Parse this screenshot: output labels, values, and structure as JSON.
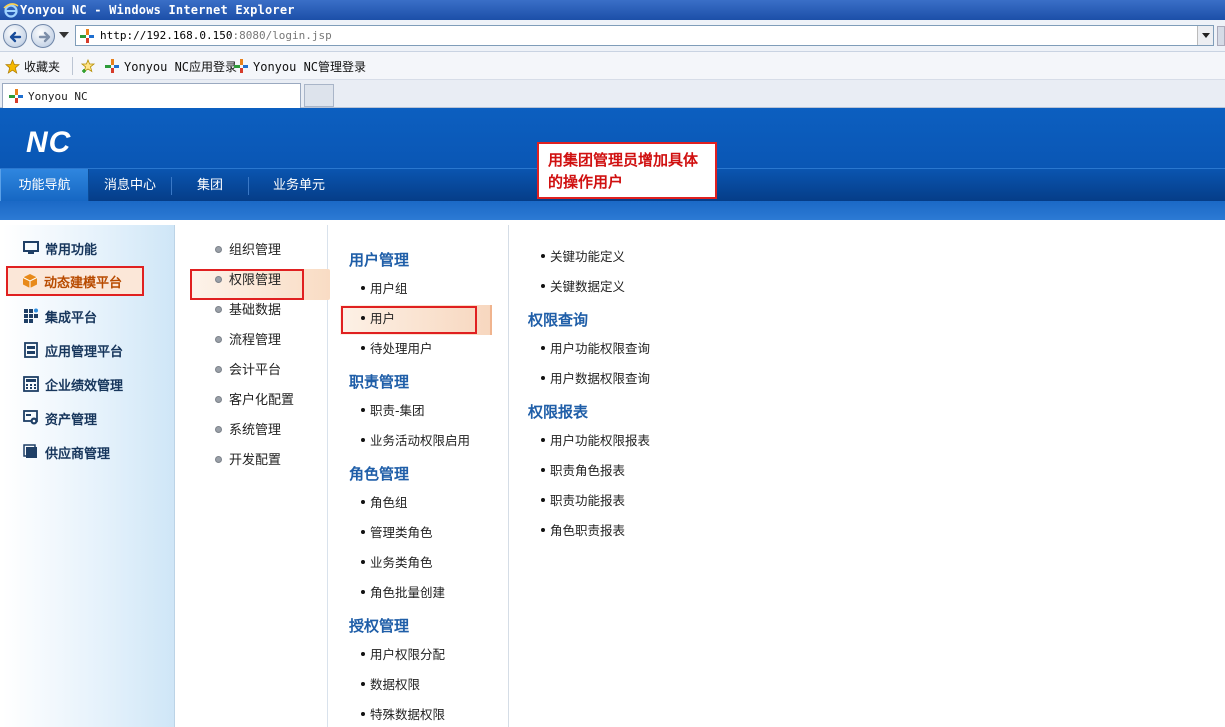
{
  "browser": {
    "window_title": "Yonyou NC - Windows Internet Explorer",
    "url_host": "http://192.168.0.150",
    "url_path": ":8080/login.jsp",
    "favorites_label": "收藏夹",
    "favorites": [
      "Yonyou NC应用登录",
      "Yonyou NC管理登录"
    ],
    "tab_title": "Yonyou NC"
  },
  "app": {
    "logo": "NC",
    "tabs": [
      "功能导航",
      "消息中心",
      "集团",
      "业务单元"
    ],
    "active_tab": "功能导航",
    "callout": "用集团管理员增加具体的操作用户",
    "callout_color": "#e02020"
  },
  "left_nav": [
    {
      "label": "常用功能",
      "icon": "monitor-icon"
    },
    {
      "label": "动态建模平台",
      "icon": "cube-icon",
      "active": true
    },
    {
      "label": "集成平台",
      "icon": "grid-icon"
    },
    {
      "label": "应用管理平台",
      "icon": "server-icon"
    },
    {
      "label": "企业绩效管理",
      "icon": "calculator-icon"
    },
    {
      "label": "资产管理",
      "icon": "asset-icon"
    },
    {
      "label": "供应商管理",
      "icon": "supplier-icon"
    }
  ],
  "modules": [
    {
      "label": "组织管理"
    },
    {
      "label": "权限管理",
      "active": true
    },
    {
      "label": "基础数据"
    },
    {
      "label": "流程管理"
    },
    {
      "label": "会计平台"
    },
    {
      "label": "客户化配置"
    },
    {
      "label": "系统管理"
    },
    {
      "label": "开发配置"
    }
  ],
  "menu_col1": {
    "groups": [
      {
        "title": "用户管理",
        "items": [
          "用户组",
          "用户",
          "待处理用户"
        ]
      },
      {
        "title": "职责管理",
        "items": [
          "职责-集团",
          "业务活动权限启用"
        ]
      },
      {
        "title": "角色管理",
        "items": [
          "角色组",
          "管理类角色",
          "业务类角色",
          "角色批量创建"
        ]
      },
      {
        "title": "授权管理",
        "items": [
          "用户权限分配",
          "数据权限",
          "特殊数据权限"
        ]
      }
    ]
  },
  "menu_col2": {
    "top_items": [
      "关键功能定义",
      "关键数据定义"
    ],
    "groups": [
      {
        "title": "权限查询",
        "items": [
          "用户功能权限查询",
          "用户数据权限查询"
        ]
      },
      {
        "title": "权限报表",
        "items": [
          "用户功能权限报表",
          "职责角色报表",
          "职责功能报表",
          "角色职责报表"
        ]
      }
    ]
  }
}
